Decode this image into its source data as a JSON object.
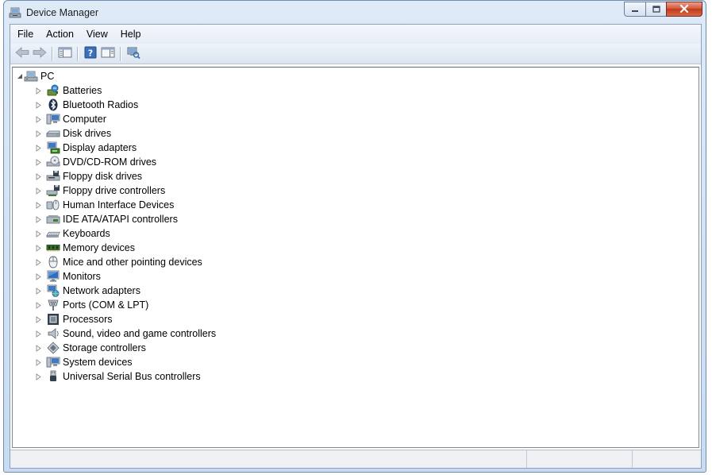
{
  "window": {
    "title": "Device Manager"
  },
  "menu": [
    "File",
    "Action",
    "View",
    "Help"
  ],
  "toolbar": {
    "buttons": [
      {
        "name": "back-button",
        "icon": "arrow-left-icon"
      },
      {
        "name": "forward-button",
        "icon": "arrow-right-icon"
      },
      {
        "name": "show-hide-console-tree-button",
        "icon": "console-tree-icon"
      },
      {
        "name": "help-button",
        "icon": "help-icon"
      },
      {
        "name": "action-pane-button",
        "icon": "action-pane-icon"
      },
      {
        "name": "scan-hardware-changes-button",
        "icon": "scan-hardware-icon"
      }
    ]
  },
  "tree": {
    "root": {
      "label": "PC",
      "icon": "computer-root-icon",
      "expanded": true
    },
    "items": [
      {
        "label": "Batteries",
        "icon": "battery-icon"
      },
      {
        "label": "Bluetooth Radios",
        "icon": "bluetooth-icon"
      },
      {
        "label": "Computer",
        "icon": "computer-icon"
      },
      {
        "label": "Disk drives",
        "icon": "disk-drive-icon"
      },
      {
        "label": "Display adapters",
        "icon": "display-adapter-icon"
      },
      {
        "label": "DVD/CD-ROM drives",
        "icon": "dvd-drive-icon"
      },
      {
        "label": "Floppy disk drives",
        "icon": "floppy-disk-icon"
      },
      {
        "label": "Floppy drive controllers",
        "icon": "floppy-controller-icon"
      },
      {
        "label": "Human Interface Devices",
        "icon": "hid-icon"
      },
      {
        "label": "IDE ATA/ATAPI controllers",
        "icon": "ide-controller-icon"
      },
      {
        "label": "Keyboards",
        "icon": "keyboard-icon"
      },
      {
        "label": "Memory devices",
        "icon": "memory-icon"
      },
      {
        "label": "Mice and other pointing devices",
        "icon": "mouse-icon"
      },
      {
        "label": "Monitors",
        "icon": "monitor-icon"
      },
      {
        "label": "Network adapters",
        "icon": "network-adapter-icon"
      },
      {
        "label": "Ports (COM & LPT)",
        "icon": "port-icon"
      },
      {
        "label": "Processors",
        "icon": "processor-icon"
      },
      {
        "label": "Sound, video and game controllers",
        "icon": "speaker-icon"
      },
      {
        "label": "Storage controllers",
        "icon": "storage-controller-icon"
      },
      {
        "label": "System devices",
        "icon": "system-devices-icon"
      },
      {
        "label": "Universal Serial Bus controllers",
        "icon": "usb-icon"
      }
    ]
  },
  "colors": {
    "frame": "#c8dbf0",
    "close_button": "#c2391a",
    "accent": "#3a6ea5"
  }
}
